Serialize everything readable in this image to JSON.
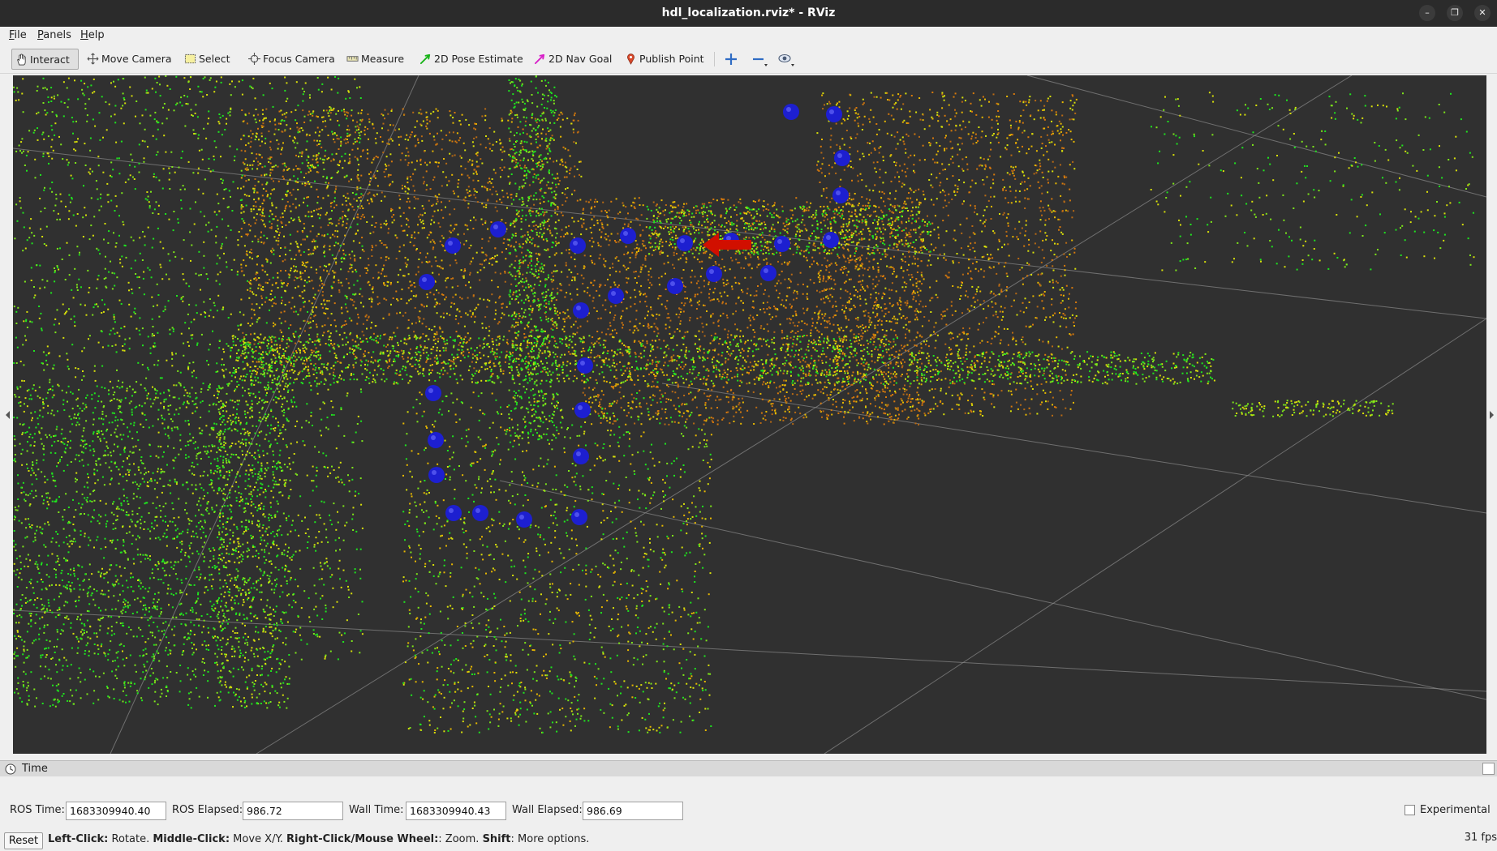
{
  "window": {
    "title": "hdl_localization.rviz* - RViz",
    "minimize_label": "–",
    "maximize_label": "❐",
    "close_label": "✕"
  },
  "menubar": {
    "items": [
      {
        "mnemonic": "F",
        "rest": "ile"
      },
      {
        "mnemonic": "P",
        "rest": "anels"
      },
      {
        "mnemonic": "H",
        "rest": "elp"
      }
    ]
  },
  "toolbar": {
    "tools": [
      {
        "label": "Interact",
        "icon": "hand-icon",
        "active": true
      },
      {
        "label": "Move Camera",
        "icon": "move-camera-icon",
        "active": false
      },
      {
        "label": "Select",
        "icon": "select-icon",
        "active": false
      },
      {
        "label": "Focus Camera",
        "icon": "focus-camera-icon",
        "active": false
      },
      {
        "label": "Measure",
        "icon": "ruler-icon",
        "active": false
      },
      {
        "label": "2D Pose Estimate",
        "icon": "green-arrow-icon",
        "active": false
      },
      {
        "label": "2D Nav Goal",
        "icon": "magenta-arrow-icon",
        "active": false
      },
      {
        "label": "Publish Point",
        "icon": "map-pin-icon",
        "active": false
      }
    ],
    "extra_icons": [
      "add-tool-icon",
      "remove-tool-icon",
      "camera-type-icon"
    ]
  },
  "viewport": {
    "background_color": "#303030",
    "grid_color": "#8a8a8a",
    "marker_color": "#1d1fd0",
    "pose_arrow_color": "#d10f00",
    "point_cloud_colors": [
      "#1ee61e",
      "#7ee61a",
      "#d8e00a",
      "#e8b800",
      "#d87a0c",
      "#b86a14"
    ]
  },
  "time_panel": {
    "title": "Time",
    "ros_time_label": "ROS Time:",
    "ros_time": "1683309940.40",
    "ros_elapsed_label": "ROS Elapsed:",
    "ros_elapsed": "986.72",
    "wall_time_label": "Wall Time:",
    "wall_time": "1683309940.43",
    "wall_elapsed_label": "Wall Elapsed:",
    "wall_elapsed": "986.69",
    "experimental_label": "Experimental",
    "experimental_checked": false
  },
  "status": {
    "reset_label": "Reset",
    "hint_1_bold": "Left-Click:",
    "hint_1_text": " Rotate. ",
    "hint_2_bold": "Middle-Click:",
    "hint_2_text": " Move X/Y. ",
    "hint_3_bold": "Right-Click/Mouse Wheel:",
    "hint_3_text": ": Zoom. ",
    "hint_4_bold": "Shift",
    "hint_4_text": ": More options.",
    "fps": "31 fps"
  }
}
